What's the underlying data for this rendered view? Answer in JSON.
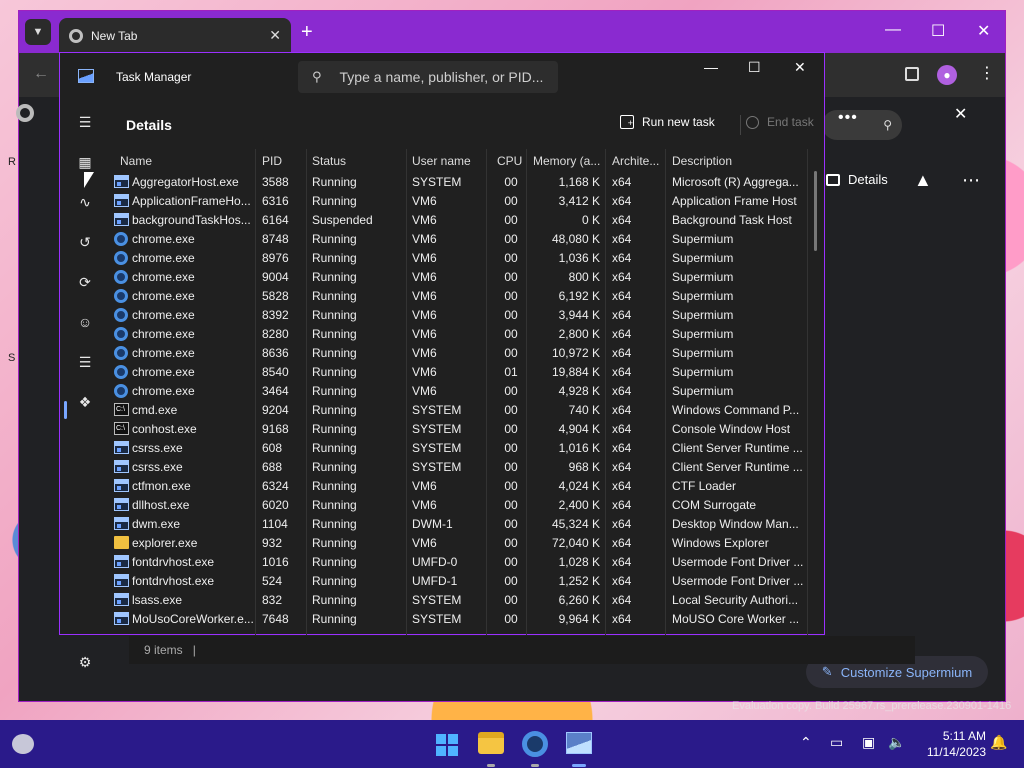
{
  "browser": {
    "tab_title": "New Tab",
    "customize_label": "Customize Supermium",
    "side_panel_details": "Details",
    "watermark": "Evaluation copy. Build 25967.rs_prerelease.230901-1416"
  },
  "task_manager": {
    "app_title": "Task Manager",
    "search_placeholder": "Type a name, publisher, or PID...",
    "page_title": "Details",
    "run_new_task": "Run new task",
    "end_task": "End task",
    "columns": {
      "name": "Name",
      "pid": "PID",
      "status": "Status",
      "user": "User name",
      "cpu": "CPU",
      "memory": "Memory (a...",
      "arch": "Archite...",
      "desc": "Description"
    },
    "processes": [
      {
        "icon": "exe",
        "name": "AggregatorHost.exe",
        "pid": "3588",
        "status": "Running",
        "user": "SYSTEM",
        "cpu": "00",
        "mem": "1,168 K",
        "arch": "x64",
        "desc": "Microsoft (R) Aggrega..."
      },
      {
        "icon": "exe",
        "name": "ApplicationFrameHo...",
        "pid": "6316",
        "status": "Running",
        "user": "VM6",
        "cpu": "00",
        "mem": "3,412 K",
        "arch": "x64",
        "desc": "Application Frame Host"
      },
      {
        "icon": "exe",
        "name": "backgroundTaskHos...",
        "pid": "6164",
        "status": "Suspended",
        "user": "VM6",
        "cpu": "00",
        "mem": "0 K",
        "arch": "x64",
        "desc": "Background Task Host"
      },
      {
        "icon": "chrome",
        "name": "chrome.exe",
        "pid": "8748",
        "status": "Running",
        "user": "VM6",
        "cpu": "00",
        "mem": "48,080 K",
        "arch": "x64",
        "desc": "Supermium"
      },
      {
        "icon": "chrome",
        "name": "chrome.exe",
        "pid": "8976",
        "status": "Running",
        "user": "VM6",
        "cpu": "00",
        "mem": "1,036 K",
        "arch": "x64",
        "desc": "Supermium"
      },
      {
        "icon": "chrome",
        "name": "chrome.exe",
        "pid": "9004",
        "status": "Running",
        "user": "VM6",
        "cpu": "00",
        "mem": "800 K",
        "arch": "x64",
        "desc": "Supermium"
      },
      {
        "icon": "chrome",
        "name": "chrome.exe",
        "pid": "5828",
        "status": "Running",
        "user": "VM6",
        "cpu": "00",
        "mem": "6,192 K",
        "arch": "x64",
        "desc": "Supermium"
      },
      {
        "icon": "chrome",
        "name": "chrome.exe",
        "pid": "8392",
        "status": "Running",
        "user": "VM6",
        "cpu": "00",
        "mem": "3,944 K",
        "arch": "x64",
        "desc": "Supermium"
      },
      {
        "icon": "chrome",
        "name": "chrome.exe",
        "pid": "8280",
        "status": "Running",
        "user": "VM6",
        "cpu": "00",
        "mem": "2,800 K",
        "arch": "x64",
        "desc": "Supermium"
      },
      {
        "icon": "chrome",
        "name": "chrome.exe",
        "pid": "8636",
        "status": "Running",
        "user": "VM6",
        "cpu": "00",
        "mem": "10,972 K",
        "arch": "x64",
        "desc": "Supermium"
      },
      {
        "icon": "chrome",
        "name": "chrome.exe",
        "pid": "8540",
        "status": "Running",
        "user": "VM6",
        "cpu": "01",
        "mem": "19,884 K",
        "arch": "x64",
        "desc": "Supermium"
      },
      {
        "icon": "chrome",
        "name": "chrome.exe",
        "pid": "3464",
        "status": "Running",
        "user": "VM6",
        "cpu": "00",
        "mem": "4,928 K",
        "arch": "x64",
        "desc": "Supermium"
      },
      {
        "icon": "cmd",
        "name": "cmd.exe",
        "pid": "9204",
        "status": "Running",
        "user": "SYSTEM",
        "cpu": "00",
        "mem": "740 K",
        "arch": "x64",
        "desc": "Windows Command P..."
      },
      {
        "icon": "cmd",
        "name": "conhost.exe",
        "pid": "9168",
        "status": "Running",
        "user": "SYSTEM",
        "cpu": "00",
        "mem": "4,904 K",
        "arch": "x64",
        "desc": "Console Window Host"
      },
      {
        "icon": "exe",
        "name": "csrss.exe",
        "pid": "608",
        "status": "Running",
        "user": "SYSTEM",
        "cpu": "00",
        "mem": "1,016 K",
        "arch": "x64",
        "desc": "Client Server Runtime ..."
      },
      {
        "icon": "exe",
        "name": "csrss.exe",
        "pid": "688",
        "status": "Running",
        "user": "SYSTEM",
        "cpu": "00",
        "mem": "968 K",
        "arch": "x64",
        "desc": "Client Server Runtime ..."
      },
      {
        "icon": "exe",
        "name": "ctfmon.exe",
        "pid": "6324",
        "status": "Running",
        "user": "VM6",
        "cpu": "00",
        "mem": "4,024 K",
        "arch": "x64",
        "desc": "CTF Loader"
      },
      {
        "icon": "exe",
        "name": "dllhost.exe",
        "pid": "6020",
        "status": "Running",
        "user": "VM6",
        "cpu": "00",
        "mem": "2,400 K",
        "arch": "x64",
        "desc": "COM Surrogate"
      },
      {
        "icon": "exe",
        "name": "dwm.exe",
        "pid": "1104",
        "status": "Running",
        "user": "DWM-1",
        "cpu": "00",
        "mem": "45,324 K",
        "arch": "x64",
        "desc": "Desktop Window Man..."
      },
      {
        "icon": "folder",
        "name": "explorer.exe",
        "pid": "932",
        "status": "Running",
        "user": "VM6",
        "cpu": "00",
        "mem": "72,040 K",
        "arch": "x64",
        "desc": "Windows Explorer"
      },
      {
        "icon": "exe",
        "name": "fontdrvhost.exe",
        "pid": "1016",
        "status": "Running",
        "user": "UMFD-0",
        "cpu": "00",
        "mem": "1,028 K",
        "arch": "x64",
        "desc": "Usermode Font Driver ..."
      },
      {
        "icon": "exe",
        "name": "fontdrvhost.exe",
        "pid": "524",
        "status": "Running",
        "user": "UMFD-1",
        "cpu": "00",
        "mem": "1,252 K",
        "arch": "x64",
        "desc": "Usermode Font Driver ..."
      },
      {
        "icon": "exe",
        "name": "lsass.exe",
        "pid": "832",
        "status": "Running",
        "user": "SYSTEM",
        "cpu": "00",
        "mem": "6,260 K",
        "arch": "x64",
        "desc": "Local Security Authori..."
      },
      {
        "icon": "exe",
        "name": "MoUsoCoreWorker.e...",
        "pid": "7648",
        "status": "Running",
        "user": "SYSTEM",
        "cpu": "00",
        "mem": "9,964 K",
        "arch": "x64",
        "desc": "MoUSO Core Worker ..."
      }
    ],
    "status_bar": "9 items"
  },
  "taskbar": {
    "time": "5:11 AM",
    "date": "11/14/2023"
  }
}
